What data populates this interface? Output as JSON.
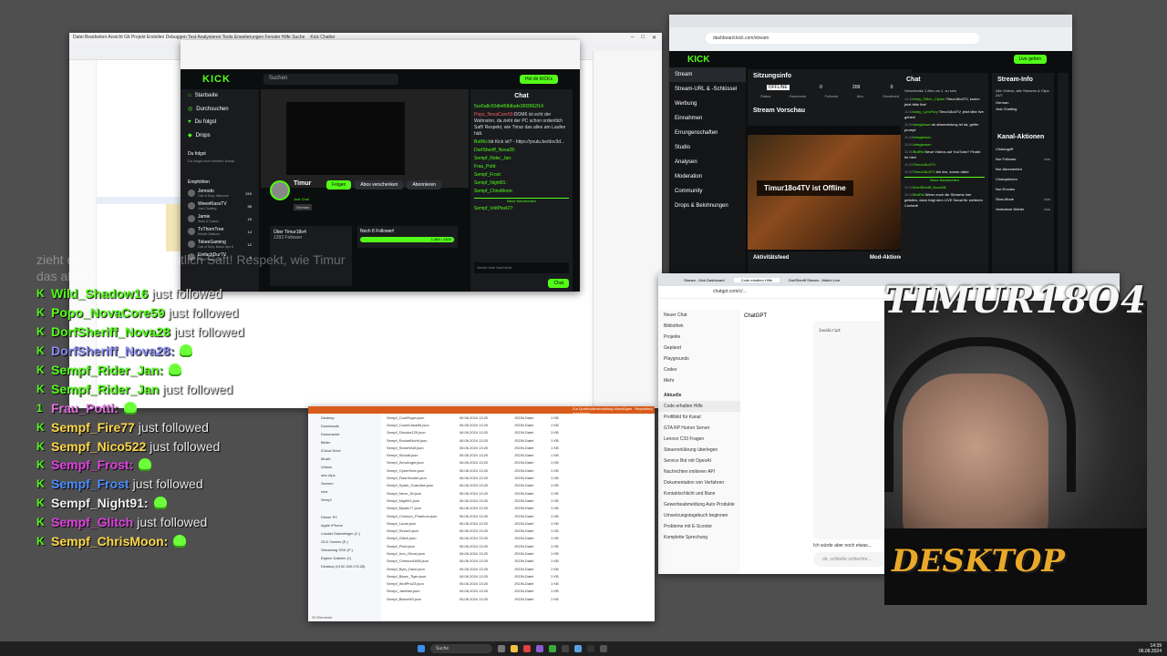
{
  "vs": {
    "title": "Kick Chatter",
    "menu": [
      "Datei",
      "Bearbeiten",
      "Ansicht",
      "Git",
      "Projekt",
      "Erstellen",
      "Debuggen",
      "Test",
      "Analysieren",
      "Tools",
      "Erweiterungen",
      "Fenster",
      "Hilfe",
      "Suche"
    ]
  },
  "kick": {
    "logo": "KICK",
    "search_placeholder": "Suchen",
    "nav": [
      "Startseite",
      "Durchsuchen",
      "Du folgst",
      "Drops"
    ],
    "following_header": "Du folgst",
    "following_empty": "Du folgst noch keinem Kanal.",
    "recommended_header": "Empfohlen",
    "recommended": [
      {
        "name": "Jomodo",
        "game": "Call of Duty: Warzone",
        "viewers": "219"
      },
      {
        "name": "WeeeKlassTV",
        "game": "Just Chatting",
        "viewers": "96"
      },
      {
        "name": "Jamie",
        "game": "Slots & Casino",
        "viewers": "19"
      },
      {
        "name": "TvThomTree",
        "game": "Mobile Stations",
        "viewers": "14"
      },
      {
        "name": "TokeeGaming",
        "game": "Call of Duty: Black Ops 6",
        "viewers": "12"
      },
      {
        "name": "EinfachDurTV",
        "game": "Final Fantasy XV",
        "viewers": "9"
      }
    ],
    "channel": {
      "name": "Timur",
      "category": "Just Chat",
      "tag": "German",
      "follow": "Folgen",
      "gift": "Abos verschenken",
      "subscribe": "Abonnieren"
    },
    "about": {
      "title": "Über Timur18o4",
      "followers": "1393 Follower"
    },
    "goal": {
      "title": "Noch 8 Follower!",
      "progress": "1.384 / 1400",
      "fraction": 0.9886
    },
    "login_btn": "Hol dir KICKs",
    "chat": {
      "header": "Chat",
      "input_placeholder": "Sende eine Nachricht",
      "send": "Chat",
      "new_messages": "Neue Nachrichten",
      "lines": [
        {
          "user": "5ce5a8c50db458dbafe36f3962f14",
          "text": ""
        },
        {
          "user": "Popo_NovaCore59:",
          "text": "DOM6 ist echt der Wahnsinn, da zieht der PC schon ordentlich Saft! Respekt, wie Timur das alles am Laufen hält."
        },
        {
          "user": "BotRix:",
          "text": "bit Kick ist? - https://youtu.be/dov3d..."
        },
        {
          "user": "DorfSheriff_Nova28:",
          "text": ""
        },
        {
          "user": "Sempf_Rider_Jan:",
          "text": ""
        },
        {
          "user": "Frau_Potti:",
          "text": ""
        },
        {
          "user": "Sempf_Frost:",
          "text": ""
        },
        {
          "user": "Sempf_Night91:",
          "text": ""
        },
        {
          "user": "Sempf_ChrisMoon:",
          "text": ""
        },
        {
          "user": "Sempf_VoltPixel27:",
          "text": ""
        }
      ]
    }
  },
  "dash": {
    "logo": "KICK",
    "url": "dashboard.kick.com/stream",
    "live_btn": "Live gehen",
    "nav": [
      "Stream",
      "Stream-URL & -Schlüssel",
      "Werbung",
      "Einnahmen",
      "Errungenschaften",
      "Studio",
      "Analysen",
      "Moderation",
      "Community",
      "Drops & Belohnungen"
    ],
    "session": {
      "title": "Sitzungsinfo",
      "status": "OFFLINE",
      "viewers": "0",
      "followers": "209",
      "subs": "0",
      "status_l": "Status",
      "viewers_l": "Zuschauer",
      "followers_l": "Follower",
      "subs_l": "Abo.",
      "duration_l": "Sendezeit"
    },
    "preview_title": "Stream Vorschau",
    "offline_text": "Timur18o4TV ist Offline",
    "offline_badge": "OFFLINE",
    "activity": "Aktivitätsfeed",
    "mod_actions": "Mod-Aktionen",
    "activity_item": {
      "user": "Timur18o4",
      "text": "folgt jetzt deinem Kanal"
    },
    "chat": {
      "header": "Chat",
      "lines": [
        {
          "t": "11:48",
          "u": "shey_Glitch_Cipher:",
          "m": "Timur18o4TV, komm jetzt bitte live!"
        },
        {
          "t": "11:48",
          "u": "shey_LynxFury:",
          "m": "Timur18o4TV, jetzt bitte live gehen!"
        },
        {
          "t": "11:50",
          "u": "shnyjesser:",
          "m": "ok abwechslung ist da, geiler prompt"
        },
        {
          "t": "11:48",
          "u": "shnyjesser:",
          "m": ""
        },
        {
          "t": "11:51",
          "u": "shnyjesser:",
          "m": ""
        },
        {
          "t": "11:50",
          "u": "BotRix:",
          "m": "Neue Videos auf YouTube? Findet ihr hier!"
        },
        {
          "t": "11:53",
          "u": "Timur18o4TV:",
          "m": ""
        },
        {
          "t": "11:53",
          "u": "Timur18o4TV:",
          "m": "bin live, komm rüber"
        }
      ],
      "new_messages": "Neue Nachrichten",
      "last": {
        "t": "12:43",
        "u": "DorfSheriff_Nova28:",
        "m": ""
      },
      "last2": {
        "t": "12:43",
        "u": "BotRix:",
        "m": "Wenn euch die Streams hier gefallen, dann folgt dem LIVE Kanal für weiteren Content!"
      },
      "sub_banner": "Verschenke 1 Abo um 1. zu sein"
    },
    "stream_info": {
      "title": "Stream-Info",
      "desc": "Alte Videos, alte Streams & Clips 24/7",
      "lang": "German",
      "category": "Just Chatting"
    },
    "channel_actions": {
      "title": "Kanal-Aktionen",
      "items": [
        {
          "label": "Chatzugriff",
          "val": ""
        },
        {
          "label": "Nur Follower",
          "val": "Aus"
        },
        {
          "label": "Nur Abonnenten",
          "val": ""
        },
        {
          "label": "Chatoptionen",
          "val": ""
        },
        {
          "label": "Nur Emotes",
          "val": ""
        },
        {
          "label": "Slow-Mode",
          "val": "Aus"
        },
        {
          "label": "Verbotene Wörter",
          "val": "Aus"
        }
      ]
    }
  },
  "gpt": {
    "tabs": [
      "Stream - Kick Dashboard",
      "Code erhalten Hilfe",
      "DorfSheriff Stream - Watch Live"
    ],
    "url": "chatgpt.com/c/...",
    "model": "ChatGPT",
    "side_top": [
      "Neuer Chat",
      "Bibliothek",
      "Projekte",
      "Gepland",
      "Playgrounds",
      "Codex",
      "Mehr"
    ],
    "side_header": "Aktuelle",
    "side_items": [
      "Code erhalten Hilfe",
      "Profilbild für Kanal",
      "GTA RP Humor Server",
      "Lenovo C33 Fragen",
      "Steuererklärung überlegen",
      "Service Bot mit OpenAI",
      "Nachrichten imitieren API",
      "Dokumentation von Verfahren",
      "Kontaktschlicht und Bann",
      "Gewerbeabmeldung Auto Produkte",
      "Umsetzungstagebuch beginnen",
      "Probleme mit E-Scooter",
      "Komplette Sprechung"
    ],
    "code_lang": "JavaScript",
    "prompt_text": "Ich würde aber noch etwas...",
    "input_placeholder": "ob, schließe schlechte..."
  },
  "exp": {
    "banner": "Zur Quellcodeverwaltung hinzufügen",
    "banner2": "Repository auswählen",
    "nav": [
      "Desktop",
      "Downloads",
      "Dokumente",
      "Bilder",
      "iCloud Drive",
      "Musik",
      "Videos",
      "obs clips",
      "Szenen",
      "new",
      "Sempf",
      "Dieser PC",
      "Apple iPhone",
      "Lokaler Datenträger (C:)",
      "OLD Games (E:)",
      "Streaming SSD (F:)",
      "Eigene Dateien (I:)",
      "Desktop (\\\\192.168.178.28)"
    ],
    "files": [
      "Sempf_ComRoger.json",
      "Sempf_CometJack56.json",
      "Sempf_Dbooke129.json",
      "Sempf_RocketNorth.json",
      "Sempf_StoneWolf.json",
      "Sempf_Skoodl.json",
      "Sempf_ZeroAngle.json",
      "Sempf_Cyber9mix.json",
      "Sempf_FlashHunter.json",
      "Sempf_Spark_Guardian.json",
      "Sempf_Neon_Dr.json",
      "Sempf_Night91.json",
      "Sempf_Mystic77.json",
      "Sempf_Crimson_Phantom.json",
      "Sempf_Lunar.json",
      "Sempf_Sinick9.json",
      "Sempf_Glitch.json",
      "Sempf_Pixel.json",
      "Sempf_Iron_Ghost.json",
      "Sempf_Crimson1698.json",
      "Sempf_Bytn_Dave.json",
      "Sempf_Blaze_Tiger.json",
      "Sempf_WolfPro23.json",
      "Sempf_JanMan.json",
      "Sempf_Blazer59.json"
    ],
    "date": "06.06.2024 13:20",
    "type": "JSON-Datei",
    "size": "1 KB",
    "status": "25 Elemente"
  },
  "feed": {
    "ghost_lines": [
      "zieht der PC schon ordentlich Saft! Respekt, wie Timur",
      "das alles am Laufen hält."
    ],
    "suffix": "just followed",
    "rows": [
      {
        "name": "Wild_Shadow16",
        "color": "#53fc18",
        "type": "follow",
        "badge": "K"
      },
      {
        "name": "Popo_NovaCore59",
        "color": "#53fc18",
        "type": "follow",
        "badge": "K"
      },
      {
        "name": "DorfSheriff_Nova28",
        "color": "#53fc18",
        "type": "follow",
        "badge": "K"
      },
      {
        "name": "DorfSheriff_Nova28:",
        "color": "#8a8cf5",
        "type": "chat",
        "badge": "K"
      },
      {
        "name": "Sempf_Rider_Jan:",
        "color": "#53fc18",
        "type": "chat",
        "badge": "K"
      },
      {
        "name": "Sempf_Rider_Jan",
        "color": "#53fc18",
        "type": "follow",
        "badge": "K"
      },
      {
        "name": "Frau_Potti:",
        "color": "#e070e0",
        "type": "chat",
        "badge": "1"
      },
      {
        "name": "Sempf_Fire77",
        "color": "#ffd84a",
        "type": "follow",
        "badge": "K"
      },
      {
        "name": "Sempf_Nico522",
        "color": "#ffd84a",
        "type": "follow",
        "badge": "K"
      },
      {
        "name": "Sempf_Frost:",
        "color": "#e040e0",
        "type": "chat",
        "badge": "K"
      },
      {
        "name": "Sempf_Frost",
        "color": "#4a8cff",
        "type": "follow",
        "badge": "K"
      },
      {
        "name": "Sempf_Night91:",
        "color": "#f0f0f0",
        "type": "chat",
        "badge": "K"
      },
      {
        "name": "Sempf_Glitch",
        "color": "#e040e0",
        "type": "follow",
        "badge": "K"
      },
      {
        "name": "Sempf_ChrisMoon:",
        "color": "#ffd84a",
        "type": "chat",
        "badge": "K"
      }
    ]
  },
  "overlay": {
    "brand_top": "TIMUR18O4",
    "brand_bottom": "DESKTOP"
  },
  "taskbar": {
    "search": "Suche",
    "time": "14:39",
    "date": "06.08.2024"
  },
  "colors": {
    "kick_green": "#53fc18",
    "taskbar": "#202020"
  }
}
